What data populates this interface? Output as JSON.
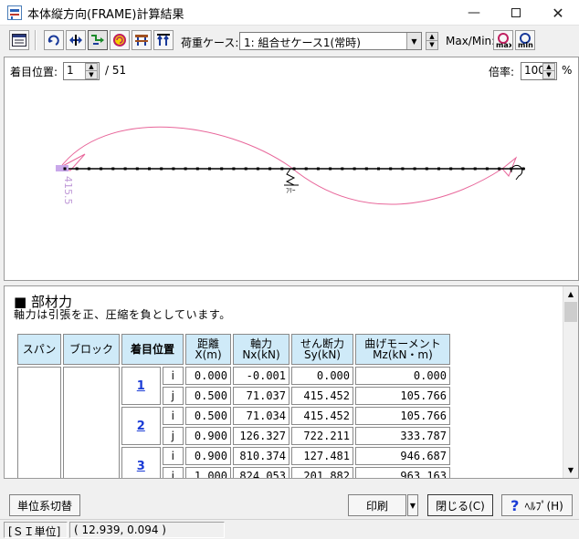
{
  "window": {
    "title": "本体縦方向(FRAME)計算結果"
  },
  "toolbar": {
    "load_case_label": "荷重ケース:",
    "load_case_value": "1: 組合せケース1(常時)",
    "maxmin_label": "Max/Min:",
    "max_label": "max",
    "min_label": "min"
  },
  "diagram": {
    "position_label": "着目位置:",
    "position_value": "1",
    "position_total": "/ 51",
    "scale_label": "倍率:",
    "scale_value": "100",
    "scale_unit": "%",
    "moment_label": "415.5",
    "support_label": "ﾌﾘｰ",
    "node_count": 39
  },
  "section": {
    "title": "■ 部材力",
    "description": "軸力は引張を正、圧縮を負としています。"
  },
  "table": {
    "headers": {
      "span": "スパン",
      "block": "ブロック",
      "point": "着目位置",
      "dist": "距離",
      "dist_unit": "X(m)",
      "axial": "軸力",
      "axial_unit": "Nx(kN)",
      "shear": "せん断力",
      "shear_unit": "Sy(kN)",
      "moment": "曲げモーメント",
      "moment_unit": "Mz(kN・m)"
    },
    "rows": [
      {
        "point": "1",
        "end": "i",
        "x": "0.000",
        "nx": "-0.001",
        "sy": "0.000",
        "mz": "0.000"
      },
      {
        "point": "1",
        "end": "j",
        "x": "0.500",
        "nx": "71.037",
        "sy": "415.452",
        "mz": "105.766"
      },
      {
        "point": "2",
        "end": "i",
        "x": "0.500",
        "nx": "71.034",
        "sy": "415.452",
        "mz": "105.766"
      },
      {
        "point": "2",
        "end": "j",
        "x": "0.900",
        "nx": "126.327",
        "sy": "722.211",
        "mz": "333.787"
      },
      {
        "point": "3",
        "end": "i",
        "x": "0.900",
        "nx": "810.374",
        "sy": "127.481",
        "mz": "946.687"
      },
      {
        "point": "3",
        "end": "j",
        "x": "1.000",
        "nx": "824.053",
        "sy": "201.882",
        "mz": "963.163"
      }
    ]
  },
  "buttons": {
    "unit_switch": "単位系切替",
    "print": "印刷",
    "close": "閉じる(C)",
    "help": "ﾍﾙﾌﾟ(H)"
  },
  "status": {
    "unit": "[ＳＩ単位]",
    "coords": "( 12.939, 0.094 )"
  },
  "colors": {
    "curve": "#e8669a",
    "beam": "#000000",
    "header_bg": "#cfeaf8",
    "link": "#1a3bd6"
  }
}
